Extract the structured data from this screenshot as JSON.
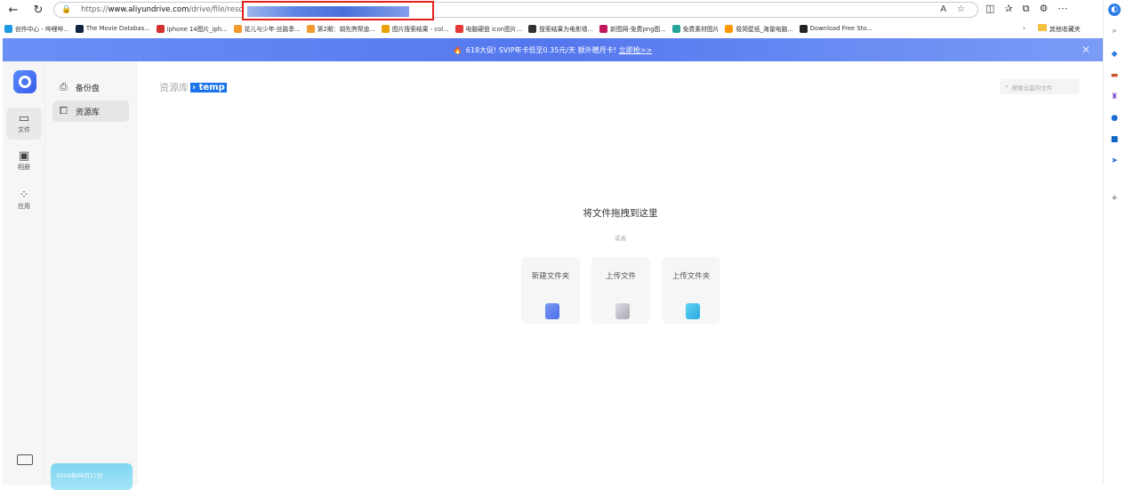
{
  "browser": {
    "url_prefix": "https://",
    "url_domain": "www.aliyundrive.com",
    "url_path": "/drive/file/resource/",
    "bookmarks": [
      {
        "label": "创作中心 - 哔哩哔...",
        "color": "#1f9be5"
      },
      {
        "label": "The Movie Databas...",
        "color": "#0d253f"
      },
      {
        "label": "iphone 14图片_iph...",
        "color": "#d32f2f"
      },
      {
        "label": "花儿与少年·丝路季...",
        "color": "#f29a2e"
      },
      {
        "label": "第2期：胡先煦帮迪...",
        "color": "#f29a2e"
      },
      {
        "label": "图片搜索结果 - col...",
        "color": "#e8a400"
      },
      {
        "label": "电脑硬盘 icon图片...",
        "color": "#e53935"
      },
      {
        "label": "搜索结果为电影墙...",
        "color": "#333333"
      },
      {
        "label": "新图网-免费png图...",
        "color": "#c2185b"
      },
      {
        "label": "免费素材图片",
        "color": "#26a69a"
      },
      {
        "label": "极简壁纸_海量电脑...",
        "color": "#ff9800"
      },
      {
        "label": "Download Free Sto...",
        "color": "#222222"
      }
    ],
    "other_bookmarks": "其他收藏夹"
  },
  "banner": {
    "text": "618大促! SVIP年卡低至0.35元/天 额外赠月卡!",
    "link": "立即抢>>"
  },
  "rail": {
    "items": [
      {
        "label": "文件"
      },
      {
        "label": "相册"
      },
      {
        "label": "应用"
      }
    ]
  },
  "subnav": {
    "items": [
      {
        "label": "备份盘"
      },
      {
        "label": "资源库"
      }
    ],
    "date": "2024年06月17日"
  },
  "main": {
    "breadcrumb_root": "资源库",
    "breadcrumb_current": "temp",
    "search_placeholder": "搜索云盘内文件",
    "empty_title": "将文件拖拽到这里",
    "empty_or": "或者",
    "actions": [
      {
        "label": "新建文件夹"
      },
      {
        "label": "上传文件"
      },
      {
        "label": "上传文件夹"
      }
    ]
  }
}
